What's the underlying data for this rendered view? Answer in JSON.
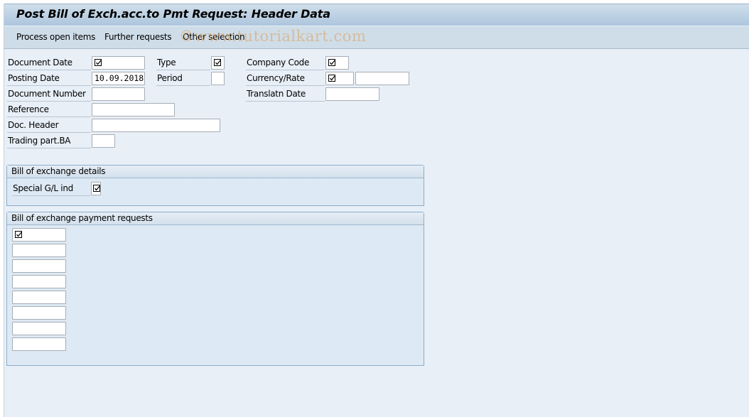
{
  "window": {
    "title": "Post Bill of Exch.acc.to Pmt Request: Header Data"
  },
  "toolbar": {
    "buttons": [
      {
        "label": "Process open items"
      },
      {
        "label": "Further requests"
      },
      {
        "label": "Other selection"
      }
    ],
    "watermark": "©www.tutorialkart.com"
  },
  "header_fields": {
    "document_date": {
      "label": "Document Date",
      "value": "",
      "required": true
    },
    "posting_date": {
      "label": "Posting Date",
      "value": "10.09.2018"
    },
    "document_number": {
      "label": "Document Number",
      "value": ""
    },
    "reference": {
      "label": "Reference",
      "value": ""
    },
    "doc_header": {
      "label": "Doc. Header",
      "value": ""
    },
    "trading_part_ba": {
      "label": "Trading part.BA",
      "value": ""
    },
    "type": {
      "label": "Type",
      "value": "",
      "required": true
    },
    "period": {
      "label": "Period",
      "value": ""
    },
    "company_code": {
      "label": "Company Code",
      "value": "",
      "required": true
    },
    "currency_rate": {
      "label": "Currency/Rate",
      "currency_value": "",
      "currency_required": true,
      "rate_value": ""
    },
    "translatn_date": {
      "label": "Translatn Date",
      "value": ""
    }
  },
  "bill_details": {
    "title": "Bill of exchange details",
    "special_gl_ind": {
      "label": "Special G/L ind",
      "value": "",
      "required": true
    }
  },
  "payment_requests": {
    "title": "Bill of exchange payment requests",
    "rows": [
      {
        "value": "",
        "required": true
      },
      {
        "value": ""
      },
      {
        "value": ""
      },
      {
        "value": ""
      },
      {
        "value": ""
      },
      {
        "value": ""
      },
      {
        "value": ""
      },
      {
        "value": ""
      }
    ]
  }
}
